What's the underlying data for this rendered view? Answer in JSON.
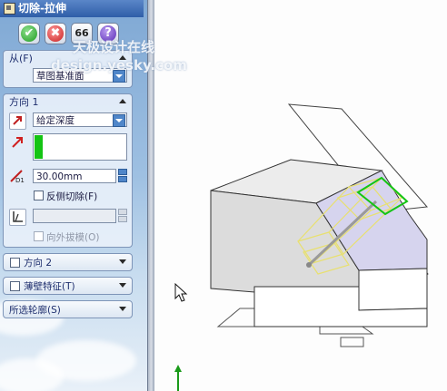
{
  "window": {
    "title": "切除-拉伸"
  },
  "buttons": {
    "ok": "✔",
    "cancel": "✖",
    "preview": "66",
    "help": "?"
  },
  "from_group": {
    "header": "从(F)",
    "start_condition": "草图基准面"
  },
  "direction1": {
    "header": "方向 1",
    "end_condition": "给定深度",
    "depth": "30.00mm",
    "flip_side_label": "反侧切除(F)",
    "draft_outward_label": "向外拔模(O)"
  },
  "direction2": {
    "header": "方向 2"
  },
  "thin_feature": {
    "header": "薄壁特征(T)"
  },
  "selected_contours": {
    "header": "所选轮廓(S)"
  },
  "watermark": {
    "line1": "天极设计在线",
    "line2": "design.yesky.com"
  },
  "colors": {
    "panel_top": "#7fa8d4",
    "titlebar": "#2f5ea8",
    "selection_green": "#14c414",
    "preview_yellow": "#e8e070",
    "lavender_face": "#d6d4ee"
  },
  "icons": {
    "ok": "check-icon",
    "cancel": "x-icon",
    "preview": "glasses-icon",
    "help": "question-icon",
    "direction": "arrow-icon",
    "depth": "ruler-icon",
    "draft": "draft-angle-icon",
    "cursor": "mouse-pointer-icon",
    "triad": "axis-triad-icon"
  }
}
